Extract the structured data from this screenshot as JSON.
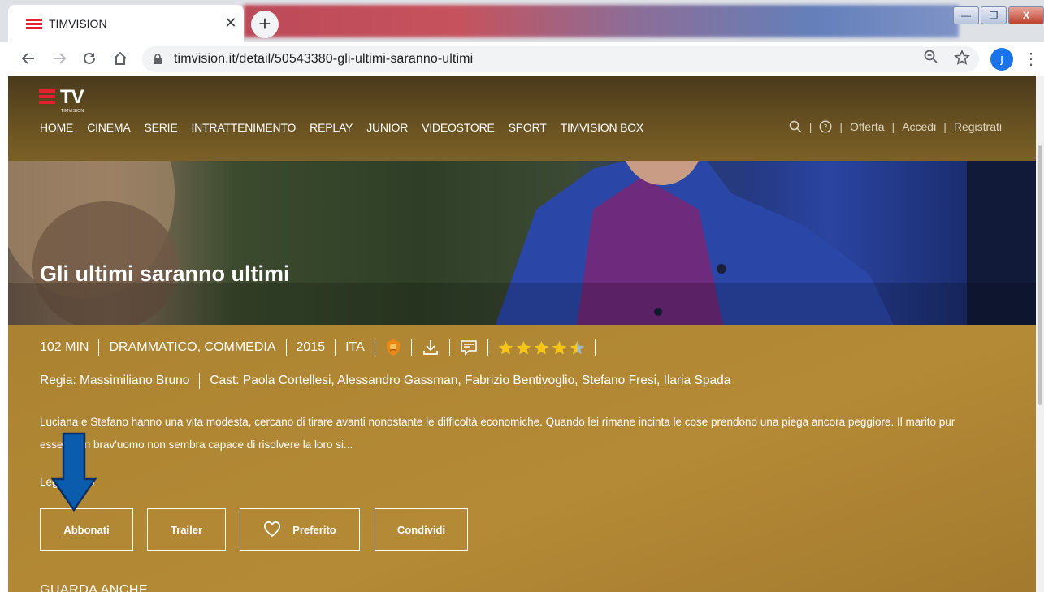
{
  "browser": {
    "tab_title": "TIMVISION",
    "tab_close": "✕",
    "new_tab": "+",
    "url": "timvision.it/detail/50543380-gli-ultimi-saranno-ultimi",
    "profile_initial": "j",
    "window_buttons": [
      "—",
      "❐",
      "X"
    ]
  },
  "site": {
    "logo_text": "TV",
    "logo_sub": "TIMVISION",
    "nav": [
      "HOME",
      "CINEMA",
      "SERIE",
      "INTRATTENIMENTO",
      "REPLAY",
      "JUNIOR",
      "VIDEOSTORE",
      "SPORT",
      "TIMVISION BOX"
    ],
    "right_nav": {
      "offerta": "Offerta",
      "accedi": "Accedi",
      "registrati": "Registrati"
    }
  },
  "movie": {
    "title": "Gli ultimi saranno ultimi",
    "duration": "102 MIN",
    "genres": "DRAMMATICO, COMMEDIA",
    "year": "2015",
    "language": "ITA",
    "rating_stars": 4.5,
    "credits": {
      "director_label": "Regia:",
      "director": "Massimiliano Bruno",
      "cast_label": "Cast:",
      "cast": "Paola Cortellesi, Alessandro Gassman, Fabrizio Bentivoglio, Stefano Fresi, Ilaria Spada"
    },
    "synopsis_line1": "Luciana e Stefano hanno una vita modesta, cercano di tirare avanti nonostante le difficoltà economiche. Quando lei rimane incinta le cose prendono una piega ancora peggiore. Il marito pur",
    "synopsis_line2": "esse     un brav'uomo non sembra capace di risolvere la loro si...",
    "read_more": "Leg        tto"
  },
  "actions": {
    "subscribe": "Abbonati",
    "trailer": "Trailer",
    "favorite": "Preferito",
    "share": "Condividi"
  },
  "section": {
    "see_also": "GUARDA ANCHE"
  },
  "colors": {
    "brand_red": "#e5202e",
    "page_gold": "#ad8432",
    "annotation_arrow": "#0b5cad"
  }
}
